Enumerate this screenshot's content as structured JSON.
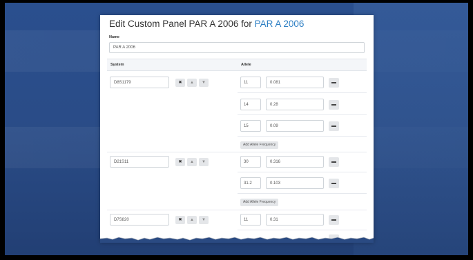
{
  "page": {
    "title_prefix": "Edit Custom Panel PAR A 2006 for ",
    "title_link": "PAR A 2006"
  },
  "name_field": {
    "label": "Name",
    "value": "PAR A 2006"
  },
  "table": {
    "headers": {
      "system": "System",
      "allele": "Allele"
    },
    "controls": {
      "remove": "✖",
      "up": "▲",
      "down": "▼",
      "add_label": "Add Allele Frequency"
    },
    "loci": [
      {
        "system": "D8S1179",
        "alleles": [
          {
            "allele": "11",
            "frequency": "0.081"
          },
          {
            "allele": "14",
            "frequency": "0.28"
          },
          {
            "allele": "15",
            "frequency": "0.09"
          }
        ]
      },
      {
        "system": "D21S11",
        "alleles": [
          {
            "allele": "30",
            "frequency": "0.316"
          },
          {
            "allele": "31.2",
            "frequency": "0.103"
          }
        ]
      },
      {
        "system": "D7S820",
        "alleles": [
          {
            "allele": "11",
            "frequency": "0.31"
          }
        ]
      }
    ]
  },
  "colors": {
    "link": "#2d7fc4",
    "background": "#2a4c87",
    "button": "#e4e6e9"
  }
}
